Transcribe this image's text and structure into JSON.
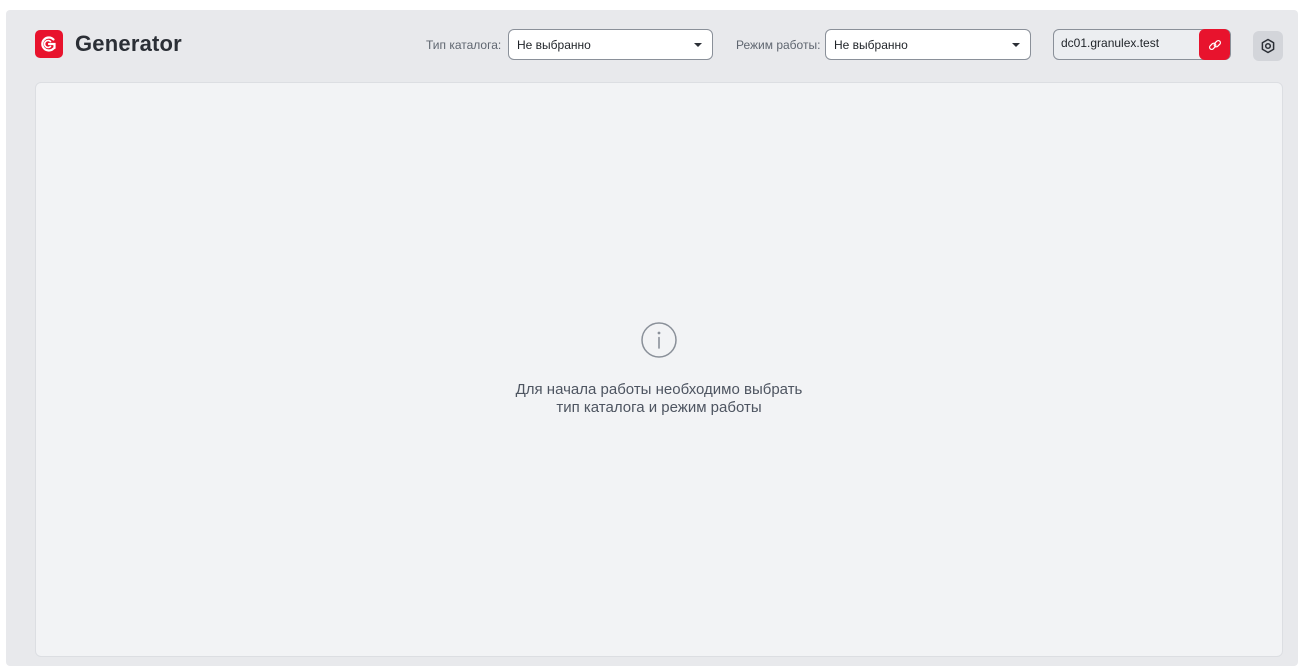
{
  "app": {
    "name": "Generator",
    "brand_color": "#e8132d"
  },
  "toolbar": {
    "catalog_type_label": "Тип каталога:",
    "catalog_type_value": "Не выбранно",
    "work_mode_label": "Режим работы:",
    "work_mode_value": "Не выбранно",
    "host_value": "dc01.granulex.test",
    "link_icon": "link-icon",
    "settings_icon": "gear-icon"
  },
  "main": {
    "empty_icon": "info-icon",
    "empty_message_line1": "Для начала работы необходимо выбрать",
    "empty_message_line2": "тип каталога и режим работы"
  }
}
